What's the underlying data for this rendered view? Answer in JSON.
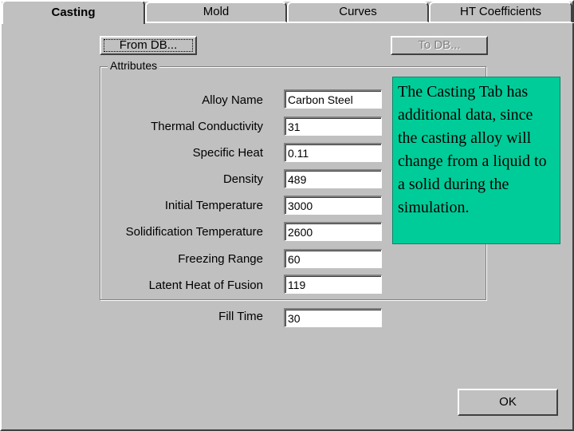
{
  "tabs": [
    {
      "label": "Casting",
      "active": true
    },
    {
      "label": "Mold",
      "active": false
    },
    {
      "label": "Curves",
      "active": false
    },
    {
      "label": "HT Coefficients",
      "active": false
    }
  ],
  "buttons": {
    "from_db": "From DB...",
    "to_db": "To DB...",
    "ok": "OK"
  },
  "attributes": {
    "group_title": "Attributes",
    "fields": [
      {
        "label": "Alloy Name",
        "value": "Carbon Steel"
      },
      {
        "label": "Thermal Conductivity",
        "value": "31"
      },
      {
        "label": "Specific Heat",
        "value": "0.11"
      },
      {
        "label": "Density",
        "value": "489"
      },
      {
        "label": "Initial Temperature",
        "value": "3000"
      },
      {
        "label": "Solidification Temperature",
        "value": "2600"
      },
      {
        "label": "Freezing Range",
        "value": "60"
      },
      {
        "label": "Latent Heat of Fusion",
        "value": "119"
      }
    ]
  },
  "fill_time": {
    "label": "Fill Time",
    "value": "30"
  },
  "note": {
    "text": "The Casting Tab has additional data, since the casting alloy will change from a liquid to a solid during the simulation.",
    "color": "#00cc99"
  }
}
